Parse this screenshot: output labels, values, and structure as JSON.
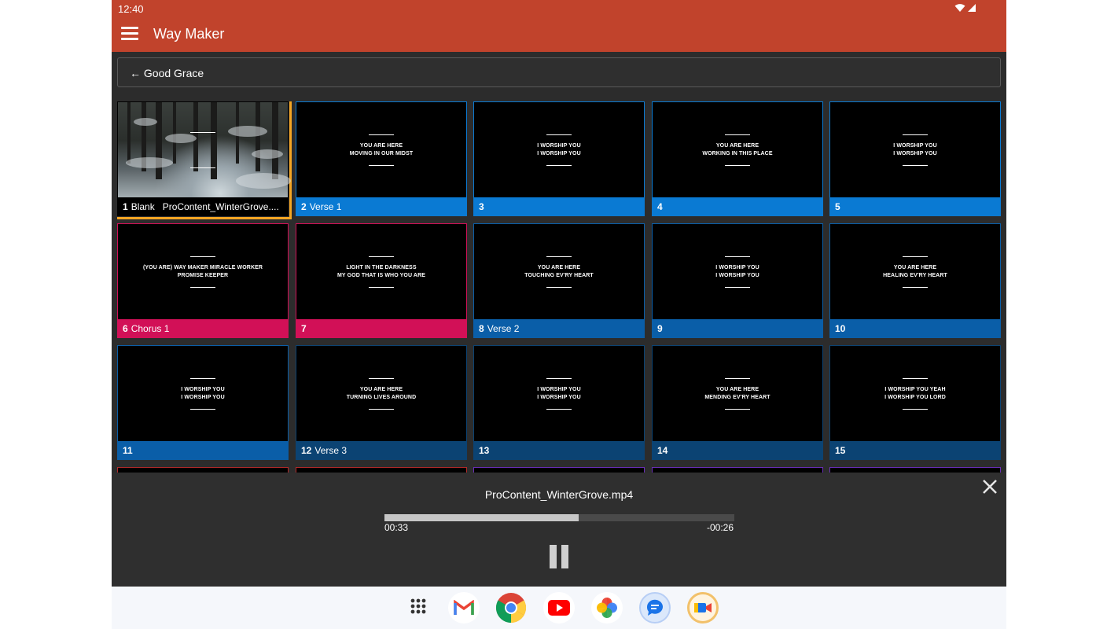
{
  "status_bar": {
    "time": "12:40"
  },
  "app_bar": {
    "title": "Way Maker"
  },
  "back_button": {
    "label": "← Good Grace"
  },
  "colors": {
    "accent": "#c1432c",
    "verse": "#0a7ad3",
    "chorus": "#d21057",
    "selected": "#f5a623",
    "bridge": "#b32b2b",
    "tag": "#6b2fb8"
  },
  "slides": [
    {
      "number": "1",
      "group": "Blank",
      "media": "ProContent_WinterGrove....",
      "lyrics": ""
    },
    {
      "number": "2",
      "group": "Verse 1",
      "media": "",
      "lyrics": "YOU ARE HERE\nMOVING IN OUR MIDST"
    },
    {
      "number": "3",
      "group": "",
      "media": "",
      "lyrics": "I WORSHIP YOU\nI WORSHIP YOU"
    },
    {
      "number": "4",
      "group": "",
      "media": "",
      "lyrics": "YOU ARE HERE\nWORKING IN THIS PLACE"
    },
    {
      "number": "5",
      "group": "",
      "media": "",
      "lyrics": "I WORSHIP YOU\nI WORSHIP YOU"
    },
    {
      "number": "6",
      "group": "Chorus 1",
      "media": "",
      "lyrics": "(YOU ARE) WAY MAKER MIRACLE WORKER\nPROMISE KEEPER"
    },
    {
      "number": "7",
      "group": "",
      "media": "",
      "lyrics": "LIGHT IN THE DARKNESS\nMY GOD THAT IS WHO YOU ARE"
    },
    {
      "number": "8",
      "group": "Verse 2",
      "media": "",
      "lyrics": "YOU ARE HERE\nTOUCHING EV'RY HEART"
    },
    {
      "number": "9",
      "group": "",
      "media": "",
      "lyrics": "I WORSHIP YOU\nI WORSHIP YOU"
    },
    {
      "number": "10",
      "group": "",
      "media": "",
      "lyrics": "YOU ARE HERE\nHEALING EV'RY HEART"
    },
    {
      "number": "11",
      "group": "",
      "media": "",
      "lyrics": "I WORSHIP YOU\nI WORSHIP YOU"
    },
    {
      "number": "12",
      "group": "Verse 3",
      "media": "",
      "lyrics": "YOU ARE HERE\nTURNING LIVES AROUND"
    },
    {
      "number": "13",
      "group": "",
      "media": "",
      "lyrics": "I WORSHIP YOU\nI WORSHIP YOU"
    },
    {
      "number": "14",
      "group": "",
      "media": "",
      "lyrics": "YOU ARE HERE\nMENDING EV'RY HEART"
    },
    {
      "number": "15",
      "group": "",
      "media": "",
      "lyrics": "I WORSHIP YOU YEAH\nI WORSHIP YOU LORD"
    }
  ],
  "player": {
    "filename": "ProContent_WinterGrove.mp4",
    "elapsed": "00:33",
    "remaining": "-00:26",
    "progress_fraction": 0.555
  },
  "dock": {
    "apps": [
      "apps-grid-icon",
      "gmail-icon",
      "chrome-icon",
      "youtube-icon",
      "photos-icon",
      "messages-icon",
      "meet-icon"
    ]
  }
}
